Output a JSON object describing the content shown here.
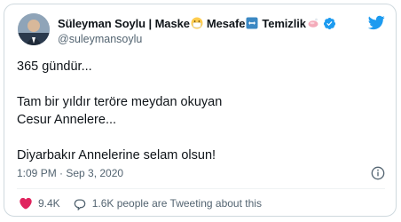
{
  "tweet": {
    "author": {
      "name_parts": [
        "Süleyman Soylu | Maske",
        "Mesafe",
        "Temizlik"
      ],
      "name_emojis": [
        "mask-emoji",
        "left-right-arrow-emoji",
        "soap-emoji"
      ],
      "handle": "@suleymansoylu",
      "verified": true
    },
    "lines": [
      "365 gündür...",
      "Tam bir yıldır teröre meydan okuyan",
      "Cesur Annelere...",
      "Diyarbakır Annelerine selam olsun!"
    ],
    "timestamp": "1:09 PM · Sep 3, 2020",
    "likes": "9.4K",
    "reply_text": "1.6K people are Tweeting about this"
  },
  "colors": {
    "brand_blue": "#1d9bf0",
    "like_red": "#e0245e",
    "secondary_text": "#536471"
  },
  "icons": [
    "twitter-bird-icon",
    "verified-badge-icon",
    "info-icon",
    "heart-icon",
    "comment-icon"
  ]
}
